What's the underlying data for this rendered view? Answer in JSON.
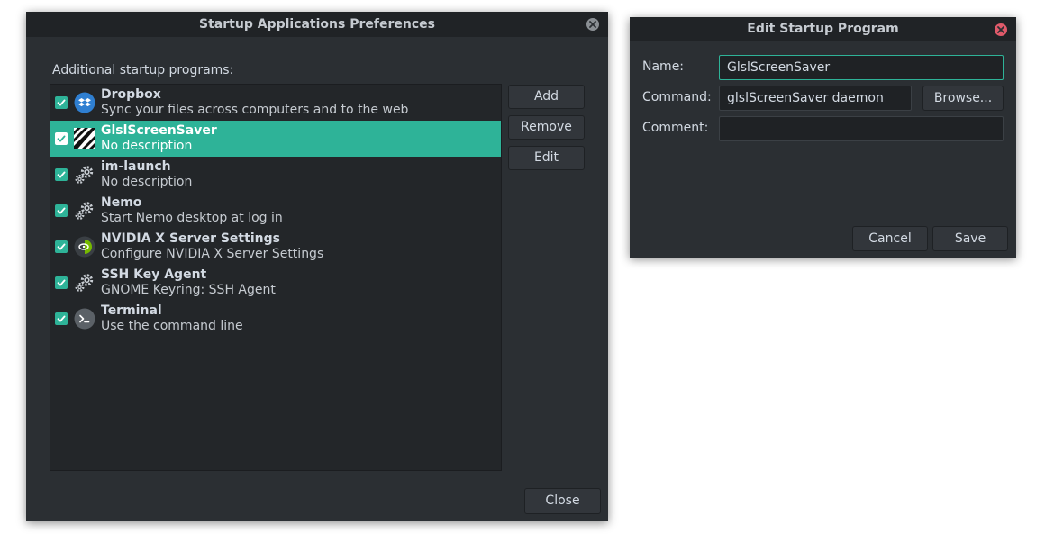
{
  "main_window": {
    "title": "Startup Applications Preferences",
    "section_label": "Additional startup programs:",
    "programs": [
      {
        "name": "Dropbox",
        "description": "Sync your files across computers and to the web",
        "icon": "dropbox-icon",
        "enabled": true,
        "selected": false
      },
      {
        "name": "GlslScreenSaver",
        "description": "No description",
        "icon": "striped-screensaver-icon",
        "enabled": true,
        "selected": true
      },
      {
        "name": "im-launch",
        "description": "No description",
        "icon": "gears-icon",
        "enabled": true,
        "selected": false
      },
      {
        "name": "Nemo",
        "description": "Start Nemo desktop at log in",
        "icon": "gears-icon",
        "enabled": true,
        "selected": false
      },
      {
        "name": "NVIDIA X Server Settings",
        "description": "Configure NVIDIA X Server Settings",
        "icon": "nvidia-icon",
        "enabled": true,
        "selected": false
      },
      {
        "name": "SSH Key Agent",
        "description": "GNOME Keyring: SSH Agent",
        "icon": "gears-icon",
        "enabled": true,
        "selected": false
      },
      {
        "name": "Terminal",
        "description": "Use the command line",
        "icon": "terminal-icon",
        "enabled": true,
        "selected": false
      }
    ],
    "buttons": {
      "add": "Add",
      "remove": "Remove",
      "edit": "Edit",
      "close": "Close"
    }
  },
  "edit_dialog": {
    "title": "Edit Startup Program",
    "name_label": "Name:",
    "name_value": "GlslScreenSaver",
    "command_label": "Command:",
    "command_value": "glslScreenSaver daemon",
    "browse_label": "Browse...",
    "comment_label": "Comment:",
    "comment_value": "",
    "cancel_label": "Cancel",
    "save_label": "Save"
  },
  "colors": {
    "accent": "#2eb398",
    "window_bg": "#2b2f33",
    "titlebar_bg": "#202326",
    "list_bg": "#232629",
    "dialog_close": "#e05a6a"
  }
}
